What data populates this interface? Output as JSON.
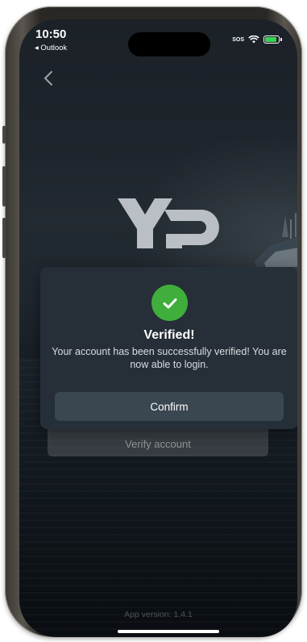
{
  "status_bar": {
    "time": "10:50",
    "back_app": "◂ Outlook",
    "sos": "SOS",
    "battery_level": 0.85
  },
  "logo": {
    "text": "YP"
  },
  "background_button": {
    "label": "Verify account"
  },
  "dialog": {
    "title": "Verified!",
    "message": "Your account has been successfully verified! You are now able to login.",
    "confirm_label": "Confirm"
  },
  "footer": {
    "app_version": "App version: 1.4.1"
  },
  "colors": {
    "success": "#3fae3b",
    "dialog_bg": "#263038",
    "button_bg": "#3a4650"
  }
}
